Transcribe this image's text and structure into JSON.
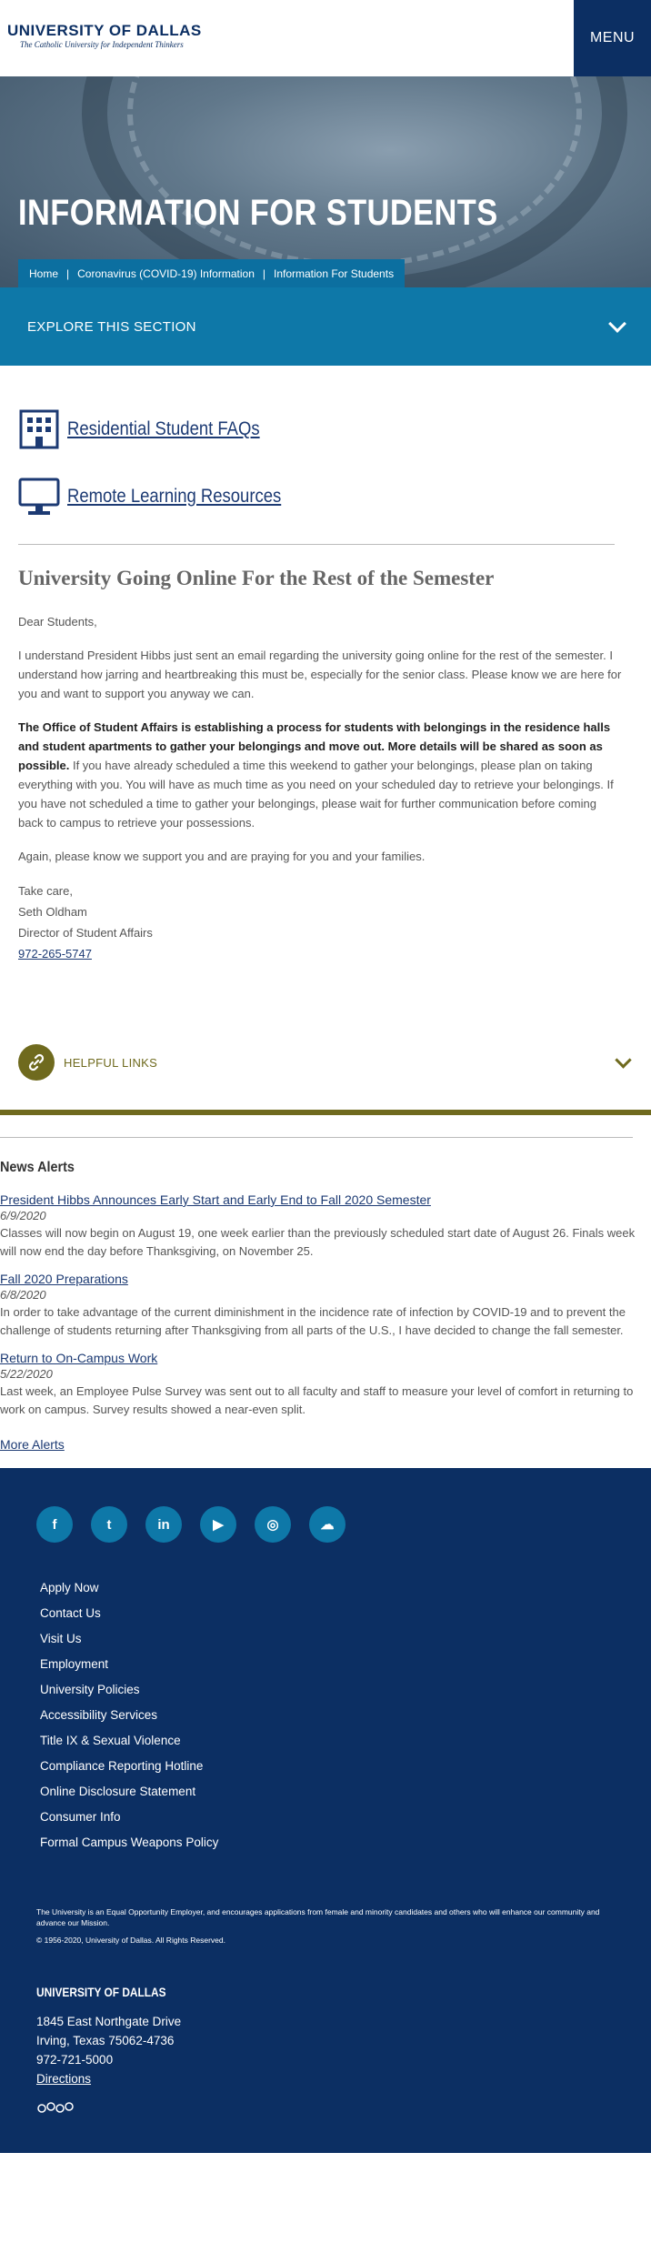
{
  "header": {
    "logo_name": "UNIVERSITY OF DALLAS",
    "logo_tagline": "The Catholic University for Independent Thinkers",
    "menu_label": "MENU"
  },
  "hero": {
    "title": "INFORMATION FOR STUDENTS",
    "breadcrumb": [
      "Home",
      "Coronavirus (COVID-19) Information",
      "Information For Students"
    ]
  },
  "explore": {
    "label": "EXPLORE THIS SECTION"
  },
  "quick_links": [
    {
      "label": "Residential Student FAQs",
      "icon": "building-icon"
    },
    {
      "label": "Remote Learning Resources",
      "icon": "monitor-icon"
    }
  ],
  "article": {
    "title": "University Going Online For the Rest of the Semester",
    "salutation": "Dear Students,",
    "p1": "I understand President Hibbs just sent an email regarding the university going online for the rest of the semester. I understand how jarring and heartbreaking this must be, especially for the senior class. Please know we are here for you and want to support you anyway we can.",
    "p2_bold": "The Office of Student Affairs is establishing a process for students with belongings in the residence halls and student apartments to gather your belongings and move out. More details will be shared as soon as possible.",
    "p2_rest": " If you have already scheduled a time this weekend to gather your belongings, please plan on taking everything with you. You will have as much time as you need on your scheduled day to retrieve your belongings. If you have not scheduled a time to gather your belongings, please wait for further communication before coming back to campus to retrieve your possessions.",
    "p3": "Again, please know we support you and are praying for you and your families.",
    "closing": "Take care,",
    "name": "Seth Oldham",
    "role": "Director of Student Affairs",
    "phone": "972-265-5747"
  },
  "helpful": {
    "label": "HELPFUL LINKS"
  },
  "news": {
    "title": "News Alerts",
    "items": [
      {
        "title": "President Hibbs Announces Early Start and Early End to Fall 2020 Semester",
        "date": "6/9/2020",
        "body": "Classes will now begin on August 19, one week earlier than the previously scheduled start date of August 26. Finals week will now end the day before Thanksgiving, on November 25."
      },
      {
        "title": "Fall 2020 Preparations",
        "date": "6/8/2020",
        "body": "In order to take advantage of the current diminishment in the incidence rate of infection by COVID-19 and to prevent the challenge of students returning after Thanksgiving from all parts of the U.S., I have decided to change the fall semester."
      },
      {
        "title": "Return to On-Campus Work",
        "date": "5/22/2020",
        "body": "Last week, an Employee Pulse Survey was sent out to all faculty and staff to measure your level of comfort in returning to work on campus. Survey results showed a near-even split."
      }
    ],
    "more_label": "More Alerts"
  },
  "footer": {
    "social": [
      {
        "name": "facebook-icon",
        "glyph": "f"
      },
      {
        "name": "twitter-icon",
        "glyph": "t"
      },
      {
        "name": "linkedin-icon",
        "glyph": "in"
      },
      {
        "name": "youtube-icon",
        "glyph": "▶"
      },
      {
        "name": "instagram-icon",
        "glyph": "◎"
      },
      {
        "name": "soundcloud-icon",
        "glyph": "☁"
      }
    ],
    "links": [
      "Apply Now",
      "Contact Us",
      "Visit Us",
      "Employment",
      "University Policies",
      "Accessibility Services",
      "Title IX & Sexual Violence",
      "Compliance Reporting Hotline",
      "Online Disclosure Statement",
      "Consumer Info",
      "Formal Campus Weapons Policy"
    ],
    "legal": "The University is an Equal Opportunity Employer, and encourages applications from female and minority candidates and others who will enhance our community and advance our Mission.",
    "copyright": "© 1956-2020, University of Dallas. All Rights Reserved.",
    "name": "UNIVERSITY OF DALLAS",
    "address1": "1845 East Northgate Drive",
    "address2": "Irving, Texas 75062-4736",
    "phone": "972-721-5000",
    "directions": "Directions"
  },
  "colors": {
    "navy": "#0c2f63",
    "blue": "#0e78a8",
    "olive": "#6f6a1e"
  }
}
